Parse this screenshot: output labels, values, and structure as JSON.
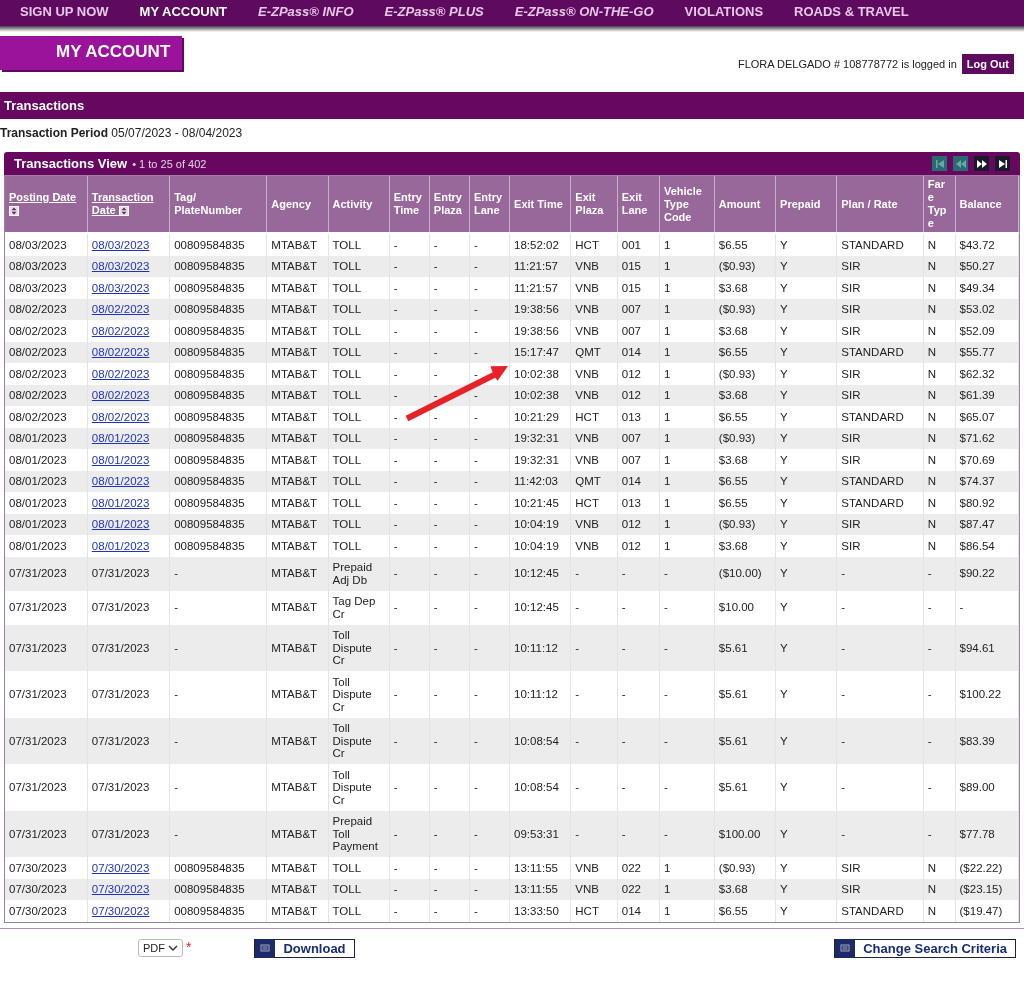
{
  "nav": [
    {
      "label": "SIGN UP NOW",
      "kind": "section",
      "selected": false
    },
    {
      "label": "MY ACCOUNT",
      "kind": "section",
      "selected": true
    },
    {
      "label": "E-ZPass® INFO",
      "kind": "product",
      "selected": false
    },
    {
      "label": "E-ZPass® PLUS",
      "kind": "product",
      "selected": false
    },
    {
      "label": "E-ZPass® ON-THE-GO",
      "kind": "product",
      "selected": false
    },
    {
      "label": "VIOLATIONS",
      "kind": "section",
      "selected": false
    },
    {
      "label": "ROADS & TRAVEL",
      "kind": "section",
      "selected": false
    }
  ],
  "page_title": "MY ACCOUNT",
  "user": {
    "status": "FLORA DELGADO # 108778772 is logged in",
    "logout": "Log Out"
  },
  "section_title": "Transactions",
  "period": {
    "label": "Transaction Period",
    "value": "05/07/2023 - 08/04/2023"
  },
  "view": {
    "title": "Transactions View",
    "range": "• 1 to 25 of 402",
    "pager": [
      {
        "kind": "first",
        "disabled": true
      },
      {
        "kind": "prev",
        "disabled": true
      },
      {
        "kind": "next",
        "disabled": false
      },
      {
        "kind": "last",
        "disabled": false
      }
    ]
  },
  "table": {
    "columns": [
      {
        "label": "Posting Date",
        "sortable": true
      },
      {
        "label": "Transaction Date",
        "sortable": true
      },
      {
        "label": "Tag/ PlateNumber",
        "sortable": false
      },
      {
        "label": "Agency",
        "sortable": false
      },
      {
        "label": "Activity",
        "sortable": false
      },
      {
        "label": "Entry Time",
        "sortable": false
      },
      {
        "label": "Entry Plaza",
        "sortable": false
      },
      {
        "label": "Entry Lane",
        "sortable": false
      },
      {
        "label": "Exit Time",
        "sortable": false
      },
      {
        "label": "Exit Plaza",
        "sortable": false
      },
      {
        "label": "Exit Lane",
        "sortable": false
      },
      {
        "label": "Vehicle Type Code",
        "sortable": false
      },
      {
        "label": "Amount",
        "sortable": false
      },
      {
        "label": "Prepaid",
        "sortable": false
      },
      {
        "label": "Plan / Rate",
        "sortable": false
      },
      {
        "label": "Fare Type",
        "sortable": false
      },
      {
        "label": "Balance",
        "sortable": false
      }
    ],
    "rows": [
      {
        "date_link": true,
        "cells": [
          "08/03/2023",
          "08/03/2023",
          "00809584835",
          "MTAB&T",
          "TOLL",
          "-",
          "-",
          "-",
          "18:52:02",
          "HCT",
          "001",
          "1",
          "$6.55",
          "Y",
          "STANDARD",
          "N",
          "$43.72"
        ]
      },
      {
        "date_link": true,
        "cells": [
          "08/03/2023",
          "08/03/2023",
          "00809584835",
          "MTAB&T",
          "TOLL",
          "-",
          "-",
          "-",
          "11:21:57",
          "VNB",
          "015",
          "1",
          "($0.93)",
          "Y",
          "SIR",
          "N",
          "$50.27"
        ]
      },
      {
        "date_link": true,
        "cells": [
          "08/03/2023",
          "08/03/2023",
          "00809584835",
          "MTAB&T",
          "TOLL",
          "-",
          "-",
          "-",
          "11:21:57",
          "VNB",
          "015",
          "1",
          "$3.68",
          "Y",
          "SIR",
          "N",
          "$49.34"
        ]
      },
      {
        "date_link": true,
        "cells": [
          "08/02/2023",
          "08/02/2023",
          "00809584835",
          "MTAB&T",
          "TOLL",
          "-",
          "-",
          "-",
          "19:38:56",
          "VNB",
          "007",
          "1",
          "($0.93)",
          "Y",
          "SIR",
          "N",
          "$53.02"
        ]
      },
      {
        "date_link": true,
        "cells": [
          "08/02/2023",
          "08/02/2023",
          "00809584835",
          "MTAB&T",
          "TOLL",
          "-",
          "-",
          "-",
          "19:38:56",
          "VNB",
          "007",
          "1",
          "$3.68",
          "Y",
          "SIR",
          "N",
          "$52.09"
        ]
      },
      {
        "date_link": true,
        "cells": [
          "08/02/2023",
          "08/02/2023",
          "00809584835",
          "MTAB&T",
          "TOLL",
          "-",
          "-",
          "-",
          "15:17:47",
          "QMT",
          "014",
          "1",
          "$6.55",
          "Y",
          "STANDARD",
          "N",
          "$55.77"
        ]
      },
      {
        "date_link": true,
        "cells": [
          "08/02/2023",
          "08/02/2023",
          "00809584835",
          "MTAB&T",
          "TOLL",
          "-",
          "-",
          "-",
          "10:02:38",
          "VNB",
          "012",
          "1",
          "($0.93)",
          "Y",
          "SIR",
          "N",
          "$62.32"
        ]
      },
      {
        "date_link": true,
        "cells": [
          "08/02/2023",
          "08/02/2023",
          "00809584835",
          "MTAB&T",
          "TOLL",
          "-",
          "-",
          "-",
          "10:02:38",
          "VNB",
          "012",
          "1",
          "$3.68",
          "Y",
          "SIR",
          "N",
          "$61.39"
        ]
      },
      {
        "date_link": true,
        "cells": [
          "08/02/2023",
          "08/02/2023",
          "00809584835",
          "MTAB&T",
          "TOLL",
          "-",
          "-",
          "-",
          "10:21:29",
          "HCT",
          "013",
          "1",
          "$6.55",
          "Y",
          "STANDARD",
          "N",
          "$65.07"
        ]
      },
      {
        "date_link": true,
        "cells": [
          "08/01/2023",
          "08/01/2023",
          "00809584835",
          "MTAB&T",
          "TOLL",
          "-",
          "-",
          "-",
          "19:32:31",
          "VNB",
          "007",
          "1",
          "($0.93)",
          "Y",
          "SIR",
          "N",
          "$71.62"
        ]
      },
      {
        "date_link": true,
        "cells": [
          "08/01/2023",
          "08/01/2023",
          "00809584835",
          "MTAB&T",
          "TOLL",
          "-",
          "-",
          "-",
          "19:32:31",
          "VNB",
          "007",
          "1",
          "$3.68",
          "Y",
          "SIR",
          "N",
          "$70.69"
        ]
      },
      {
        "date_link": true,
        "cells": [
          "08/01/2023",
          "08/01/2023",
          "00809584835",
          "MTAB&T",
          "TOLL",
          "-",
          "-",
          "-",
          "11:42:03",
          "QMT",
          "014",
          "1",
          "$6.55",
          "Y",
          "STANDARD",
          "N",
          "$74.37"
        ]
      },
      {
        "date_link": true,
        "cells": [
          "08/01/2023",
          "08/01/2023",
          "00809584835",
          "MTAB&T",
          "TOLL",
          "-",
          "-",
          "-",
          "10:21:45",
          "HCT",
          "013",
          "1",
          "$6.55",
          "Y",
          "STANDARD",
          "N",
          "$80.92"
        ]
      },
      {
        "date_link": true,
        "cells": [
          "08/01/2023",
          "08/01/2023",
          "00809584835",
          "MTAB&T",
          "TOLL",
          "-",
          "-",
          "-",
          "10:04:19",
          "VNB",
          "012",
          "1",
          "($0.93)",
          "Y",
          "SIR",
          "N",
          "$87.47"
        ]
      },
      {
        "date_link": true,
        "cells": [
          "08/01/2023",
          "08/01/2023",
          "00809584835",
          "MTAB&T",
          "TOLL",
          "-",
          "-",
          "-",
          "10:04:19",
          "VNB",
          "012",
          "1",
          "$3.68",
          "Y",
          "SIR",
          "N",
          "$86.54"
        ]
      },
      {
        "date_link": false,
        "cells": [
          "07/31/2023",
          "07/31/2023",
          "-",
          "MTAB&T",
          "Prepaid Adj Db",
          "-",
          "-",
          "-",
          "10:12:45",
          "-",
          "-",
          "-",
          "($10.00)",
          "Y",
          "-",
          "-",
          "$90.22"
        ]
      },
      {
        "date_link": false,
        "cells": [
          "07/31/2023",
          "07/31/2023",
          "-",
          "MTAB&T",
          "Tag Dep Cr",
          "-",
          "-",
          "-",
          "10:12:45",
          "-",
          "-",
          "-",
          "$10.00",
          "Y",
          "-",
          "-",
          "-"
        ]
      },
      {
        "date_link": false,
        "cells": [
          "07/31/2023",
          "07/31/2023",
          "-",
          "MTAB&T",
          "Toll Dispute Cr",
          "-",
          "-",
          "-",
          "10:11:12",
          "-",
          "-",
          "-",
          "$5.61",
          "Y",
          "-",
          "-",
          "$94.61"
        ]
      },
      {
        "date_link": false,
        "cells": [
          "07/31/2023",
          "07/31/2023",
          "-",
          "MTAB&T",
          "Toll Dispute Cr",
          "-",
          "-",
          "-",
          "10:11:12",
          "-",
          "-",
          "-",
          "$5.61",
          "Y",
          "-",
          "-",
          "$100.22"
        ]
      },
      {
        "date_link": false,
        "cells": [
          "07/31/2023",
          "07/31/2023",
          "-",
          "MTAB&T",
          "Toll Dispute Cr",
          "-",
          "-",
          "-",
          "10:08:54",
          "-",
          "-",
          "-",
          "$5.61",
          "Y",
          "-",
          "-",
          "$83.39"
        ]
      },
      {
        "date_link": false,
        "cells": [
          "07/31/2023",
          "07/31/2023",
          "-",
          "MTAB&T",
          "Toll Dispute Cr",
          "-",
          "-",
          "-",
          "10:08:54",
          "-",
          "-",
          "-",
          "$5.61",
          "Y",
          "-",
          "-",
          "$89.00"
        ]
      },
      {
        "date_link": false,
        "cells": [
          "07/31/2023",
          "07/31/2023",
          "-",
          "MTAB&T",
          "Prepaid Toll Payment",
          "-",
          "-",
          "-",
          "09:53:31",
          "-",
          "-",
          "-",
          "$100.00",
          "Y",
          "-",
          "-",
          "$77.78"
        ]
      },
      {
        "date_link": true,
        "cells": [
          "07/30/2023",
          "07/30/2023",
          "00809584835",
          "MTAB&T",
          "TOLL",
          "-",
          "-",
          "-",
          "13:11:55",
          "VNB",
          "022",
          "1",
          "($0.93)",
          "Y",
          "SIR",
          "N",
          "($22.22)"
        ]
      },
      {
        "date_link": true,
        "cells": [
          "07/30/2023",
          "07/30/2023",
          "00809584835",
          "MTAB&T",
          "TOLL",
          "-",
          "-",
          "-",
          "13:11:55",
          "VNB",
          "022",
          "1",
          "$3.68",
          "Y",
          "SIR",
          "N",
          "($23.15)"
        ]
      },
      {
        "date_link": true,
        "cells": [
          "07/30/2023",
          "07/30/2023",
          "00809584835",
          "MTAB&T",
          "TOLL",
          "-",
          "-",
          "-",
          "13:33:50",
          "HCT",
          "014",
          "1",
          "$6.55",
          "Y",
          "STANDARD",
          "N",
          "($19.47)"
        ]
      }
    ]
  },
  "footer": {
    "format": "PDF",
    "required_mark": "*",
    "download": "Download",
    "change": "Change Search Criteria"
  }
}
